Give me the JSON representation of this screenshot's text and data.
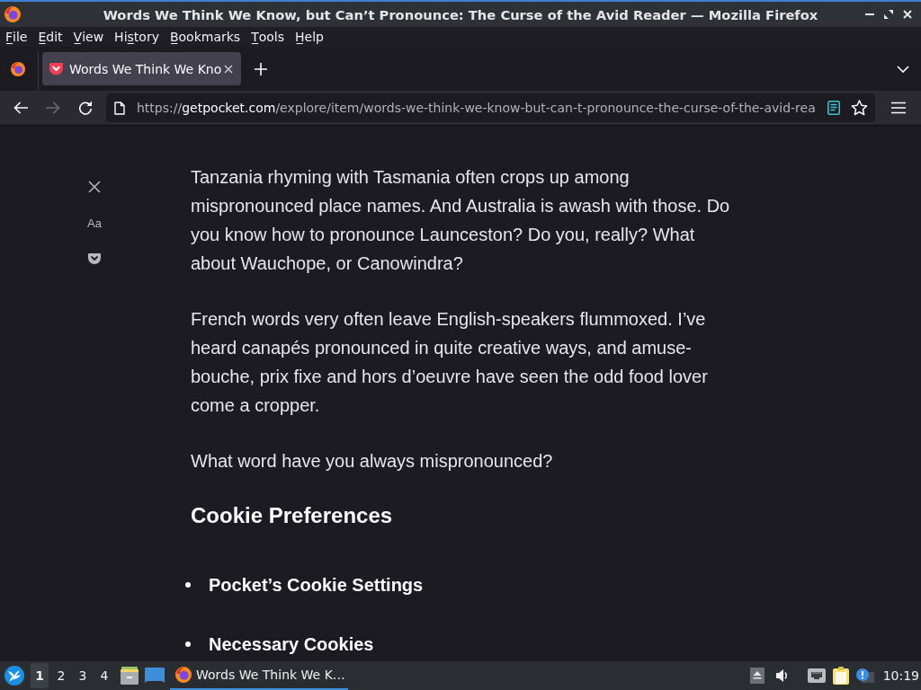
{
  "window": {
    "title": "Words We Think We Know, but Can’t Pronounce: The Curse of the Avid Reader — Mozilla Firefox"
  },
  "menu_bar": [
    {
      "label": "F̲ile"
    },
    {
      "label": "E̲dit"
    },
    {
      "label": "V̲iew"
    },
    {
      "label": "His̲tory"
    },
    {
      "label": "B̲ookmarks"
    },
    {
      "label": "T̲ools"
    },
    {
      "label": "H̲elp"
    }
  ],
  "tabs": [
    {
      "title": "Words We Think We Kno",
      "selected": true
    }
  ],
  "nav_buttons": [
    {
      "kind": "back",
      "disabled": false
    },
    {
      "kind": "forward",
      "disabled": true
    },
    {
      "kind": "reload",
      "disabled": false
    }
  ],
  "address_bar": {
    "url_scheme": "https://",
    "url_host": "getpocket.com",
    "url_path": "/explore/item/words-we-think-we-know-but-can-t-pronounce-the-curse-of-the-avid-rea",
    "reader_view_active": true,
    "bookmarked": false
  },
  "reader_sidebar": {
    "text_settings_label": "Aa"
  },
  "article": {
    "paragraphs": [
      "Tanzania rhyming with Tasmania often crops up among mispronounced place names. And Australia is awash with those. Do you know how to pronounce Launceston? Do you, really? What about Wauchope, or Canowindra?",
      "French words very often leave English-speakers flummoxed. I’ve heard canapés pronounced in quite creative ways, and amuse-bouche, prix fixe and hors d’oeuvre have seen the odd food lover come a cropper.",
      "What word have you always mispronounced?"
    ],
    "heading": "Cookie Preferences",
    "list_items": [
      "Pocket’s Cookie Settings",
      "Necessary Cookies"
    ]
  },
  "taskbar": {
    "workspaces": [
      {
        "label": "1",
        "selected": true
      },
      {
        "label": "2",
        "selected": false
      },
      {
        "label": "3",
        "selected": false
      },
      {
        "label": "4",
        "selected": false
      }
    ],
    "tasks": [
      {
        "title": "Words We Think We K…",
        "active": true
      }
    ],
    "clock": "10:19"
  }
}
